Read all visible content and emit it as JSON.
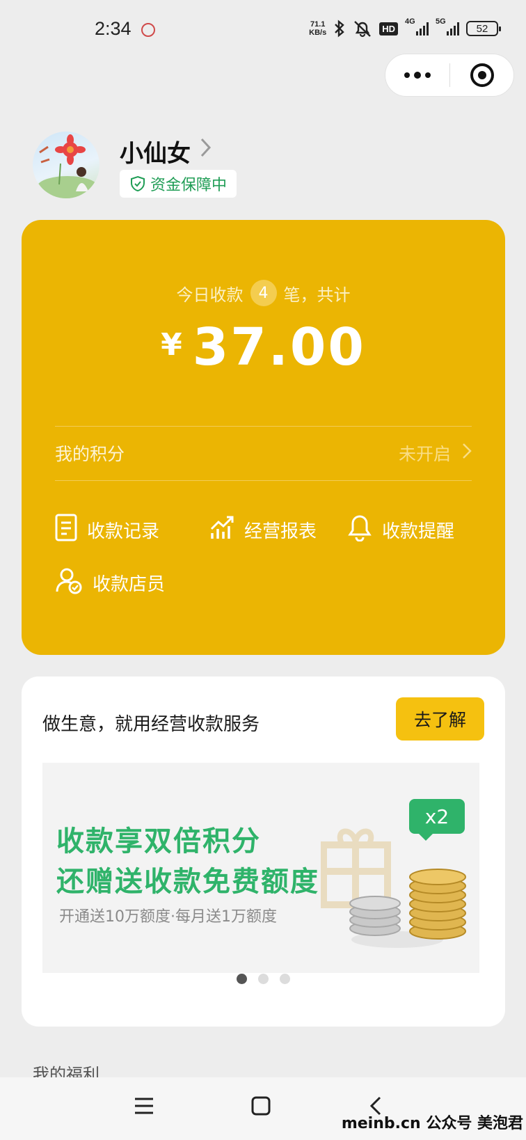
{
  "status_bar": {
    "time": "2:34",
    "net_speed_value": "71.1",
    "net_speed_unit": "KB/s",
    "hd_label": "HD",
    "signal1_label": "4G",
    "signal2_label": "5G",
    "battery": "52"
  },
  "profile": {
    "name": "小仙女",
    "guarantee_label": "资金保障中"
  },
  "summary": {
    "today_prefix": "今日收款",
    "today_count": "4",
    "today_suffix": "笔，共计",
    "currency": "¥",
    "amount": "37.00"
  },
  "points": {
    "label": "我的积分",
    "status": "未开启"
  },
  "actions": {
    "records": "收款记录",
    "reports": "经营报表",
    "reminder": "收款提醒",
    "staff": "收款店员"
  },
  "promo": {
    "title": "做生意，就用经营收款服务",
    "button": "去了解",
    "banner_line1": "收款享双倍积分",
    "banner_line2": "还赠送收款免费额度",
    "banner_sub": "开通送10万额度·每月送1万额度",
    "badge": "x2",
    "active_slide": 1,
    "slide_count": 3
  },
  "next_section_peek": "我的福利",
  "watermark": "meinb.cn  公众号 美泡君",
  "colors": {
    "card_yellow": "#ebb503",
    "accent_green": "#2fb36a",
    "button_yellow": "#f5c110"
  }
}
